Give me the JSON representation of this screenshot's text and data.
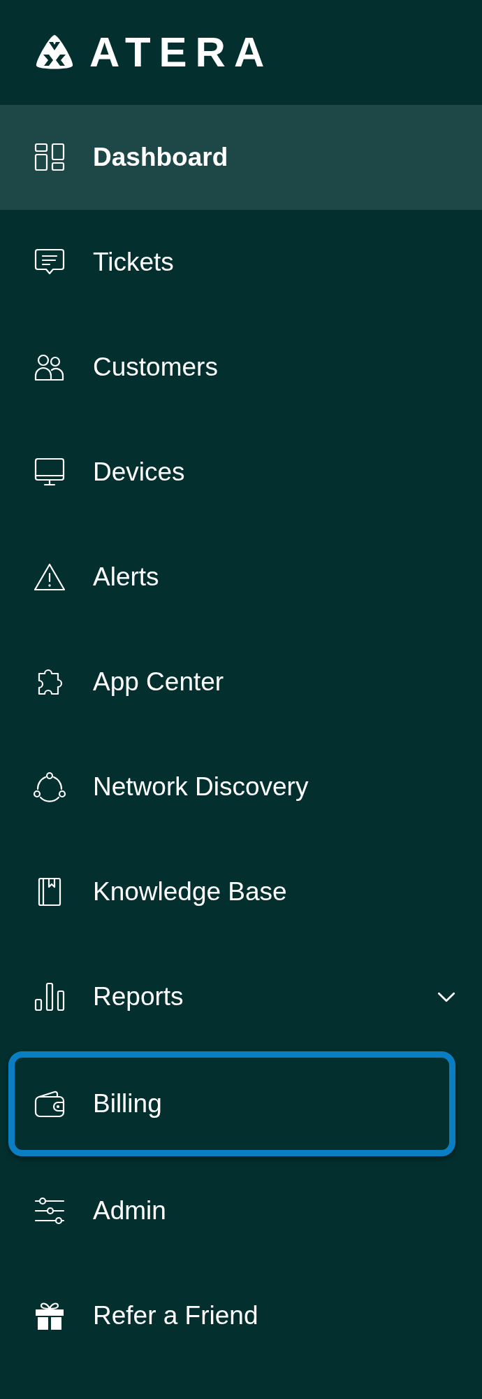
{
  "logo": {
    "text": "ATERA"
  },
  "nav_items": [
    {
      "label": "Dashboard",
      "selected": true,
      "highlighted": false
    },
    {
      "label": "Tickets",
      "selected": false,
      "highlighted": false
    },
    {
      "label": "Customers",
      "selected": false,
      "highlighted": false
    },
    {
      "label": "Devices",
      "selected": false,
      "highlighted": false
    },
    {
      "label": "Alerts",
      "selected": false,
      "highlighted": false
    },
    {
      "label": "App Center",
      "selected": false,
      "highlighted": false
    },
    {
      "label": "Network Discovery",
      "selected": false,
      "highlighted": false
    },
    {
      "label": "Knowledge Base",
      "selected": false,
      "highlighted": false
    },
    {
      "label": "Reports",
      "selected": false,
      "highlighted": false,
      "expanded": false
    },
    {
      "label": "Billing",
      "selected": false,
      "highlighted": true
    },
    {
      "label": "Admin",
      "selected": false,
      "highlighted": false
    },
    {
      "label": "Refer a Friend",
      "selected": false,
      "highlighted": false
    }
  ]
}
